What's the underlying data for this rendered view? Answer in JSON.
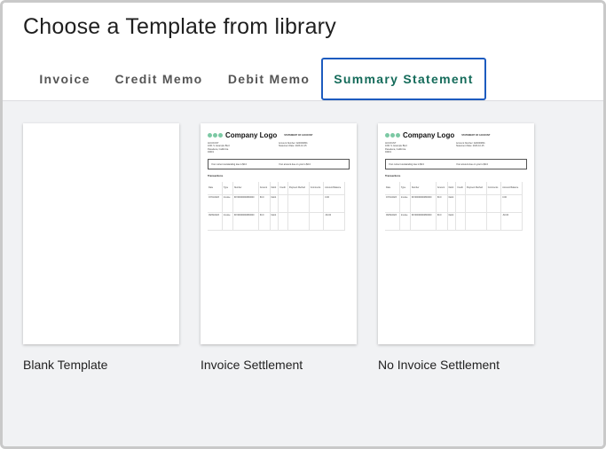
{
  "dialog": {
    "title": "Choose a Template from library"
  },
  "tabs": [
    {
      "label": "Invoice",
      "active": false
    },
    {
      "label": "Credit Memo",
      "active": false
    },
    {
      "label": "Debit Memo",
      "active": false
    },
    {
      "label": "Summary Statement",
      "active": true
    }
  ],
  "colors": {
    "active_tab_border": "#1d5bbf",
    "active_tab_text": "#146b5a",
    "logo_dots": "#7cc9a4"
  },
  "templates": [
    {
      "label": "Blank Template",
      "blank": true
    },
    {
      "label": "Invoice Settlement",
      "blank": false
    },
    {
      "label": "No Invoice Settlement",
      "blank": false
    }
  ],
  "preview": {
    "logo": "Company Logo",
    "heading": "STATEMENT OF ACCOUNT",
    "company_lines": [
      "ACCOUNT",
      "1001 S. Example Blvd",
      "Pasadena, California",
      "94019"
    ],
    "account_number": "Account Number: A00000801",
    "statement_date": "Statement Date: 2023-10-15",
    "box_left": "Your current outstanding due is $0.0",
    "box_right": "Your amount due on your is $0.0",
    "section_title": "Transactions",
    "columns": [
      "Date",
      "Type",
      "Number",
      "Amount",
      "Debit",
      "Credit",
      "Payment Method",
      "Comments",
      "Account Balance"
    ],
    "rows": [
      [
        "07/01/2023",
        "Invoice",
        "INV00000000800000",
        "60.0",
        "Debit",
        "",
        "",
        "",
        "0.00"
      ],
      [
        "09/09/2023",
        "Invoice",
        "INV00000000800000",
        "60.0",
        "Debit",
        "",
        "",
        "",
        "-60.00"
      ]
    ]
  }
}
